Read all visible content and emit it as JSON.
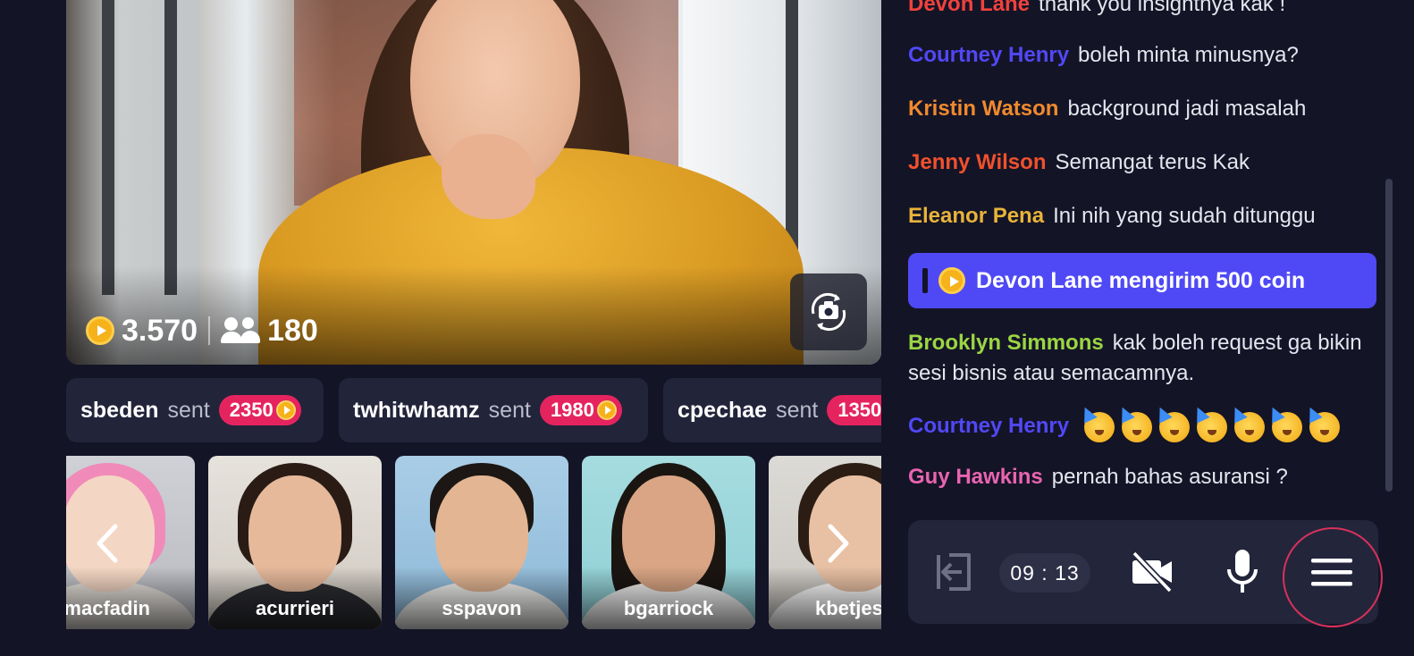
{
  "stream": {
    "coins": "3.570",
    "viewers": "180"
  },
  "gifts": [
    {
      "user": "sbeden",
      "verb": "sent",
      "amount": "2350"
    },
    {
      "user": "twhitwhamz",
      "verb": "sent",
      "amount": "1980"
    },
    {
      "user": "cpechae",
      "verb": "sent",
      "amount": "1350"
    }
  ],
  "participants": [
    {
      "name": "macfadin"
    },
    {
      "name": "acurrieri"
    },
    {
      "name": "sspavon"
    },
    {
      "name": "bgarriock"
    },
    {
      "name": "kbetjes"
    }
  ],
  "chat": {
    "messages": [
      {
        "name": "Devon Lane",
        "text": "thank you insightnya kak !",
        "color": "#f0423c"
      },
      {
        "name": "Courtney Henry",
        "text": "boleh minta minusnya?",
        "color": "#5148f6"
      },
      {
        "name": "Kristin Watson",
        "text": "background jadi masalah",
        "color": "#f08a2e"
      },
      {
        "name": "Jenny Wilson",
        "text": "Semangat terus Kak",
        "color": "#f0512c"
      },
      {
        "name": "Eleanor Pena",
        "text": "Ini nih yang sudah ditunggu",
        "color": "#e8b33a"
      },
      {
        "name": "Brooklyn Simmons",
        "text": "kak boleh request ga bikin sesi  bisnis atau semacamnya.",
        "color": "#9bd642"
      },
      {
        "name": "Courtney Henry",
        "text": "",
        "color": "#5148f6"
      },
      {
        "name": "Guy Hawkins",
        "text": "pernah bahas asuransi ?",
        "color": "#e964b0"
      }
    ],
    "system_message": "Devon Lane mengirim 500 coin",
    "emoji_count_label": "partying-face x7"
  },
  "controls": {
    "timer": "09 : 13"
  },
  "colors": {
    "background": "#141427",
    "accent": "#4f49f5",
    "gift_badge": "#e5245f",
    "coin": "#f6b21a"
  }
}
